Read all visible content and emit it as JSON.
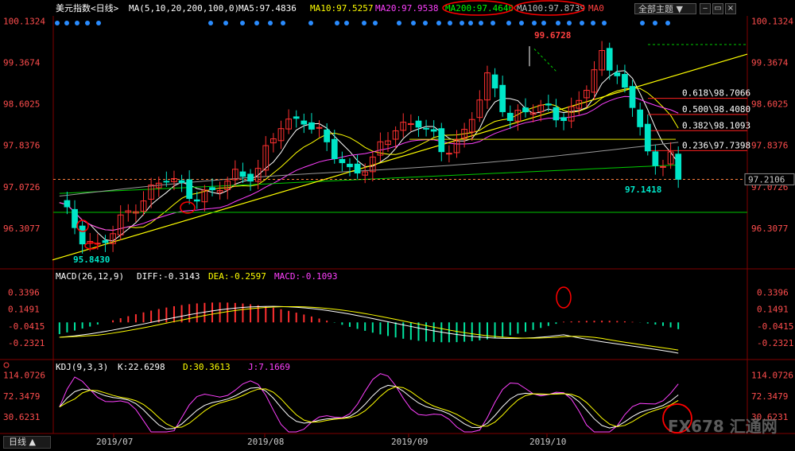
{
  "header": {
    "instrument": "美元指数<日线>",
    "ma_params": "MA(5,10,20,200,100,0)",
    "ma5": "MA5:97.4836",
    "ma10": "MA10:97.5257",
    "ma20": "MA20:97.9538",
    "ma200": "MA200:97.4640",
    "ma100": "MA100:97.8739",
    "ma0": "MA0",
    "theme_button": "全部主题",
    "theme_arrow": "▼"
  },
  "macd_header": {
    "params": "MACD(26,12,9)",
    "diff": "DIFF:-0.3143",
    "dea": "DEA:-0.2597",
    "macd": "MACD:-0.1093"
  },
  "kdj_header": {
    "params": "KDJ(9,3,3)",
    "k": "K:22.6298",
    "d": "D:30.3613",
    "j": "J:7.1669"
  },
  "footer": {
    "period": "日线",
    "period_arrow": "▲"
  },
  "watermark": "FX678 汇通网",
  "chart_data": [
    {
      "type": "candlestick",
      "title": "美元指数<日线>",
      "y_ticks": [
        "100.1324",
        "99.3674",
        "98.6025",
        "97.8376",
        "97.0726",
        "96.3077"
      ],
      "x_ticks": [
        "2019/07",
        "2019/08",
        "2019/09",
        "2019/10"
      ],
      "ylim": [
        95.6,
        100.2
      ],
      "annotations": {
        "high": "99.6728",
        "low": "95.8430",
        "recent_low": "97.1418",
        "current_price": "97.2106"
      },
      "fibonacci": [
        {
          "label": "0.618\\98.7066",
          "value": 98.7066
        },
        {
          "label": "0.500\\98.4080",
          "value": 98.408
        },
        {
          "label": "0.382\\98.1093",
          "value": 98.1093
        },
        {
          "label": "0.236\\97.7398",
          "value": 97.7398
        }
      ],
      "series": [
        {
          "name": "MA5",
          "value": 97.4836
        },
        {
          "name": "MA10",
          "value": 97.5257
        },
        {
          "name": "MA20",
          "value": 97.9538
        },
        {
          "name": "MA200",
          "value": 97.464
        },
        {
          "name": "MA100",
          "value": 97.8739
        }
      ]
    },
    {
      "type": "bar",
      "title": "MACD(26,12,9)",
      "y_ticks": [
        "0.3396",
        "0.1491",
        "-0.0415",
        "-0.2321"
      ],
      "ylim": [
        -0.4,
        0.45
      ],
      "series": [
        {
          "name": "DIFF",
          "value": -0.3143
        },
        {
          "name": "DEA",
          "value": -0.2597
        },
        {
          "name": "MACD",
          "value": -0.1093
        }
      ]
    },
    {
      "type": "line",
      "title": "KDJ(9,3,3)",
      "y_ticks": [
        "114.0726",
        "72.3479",
        "30.6231"
      ],
      "ylim": [
        0,
        120
      ],
      "series": [
        {
          "name": "K",
          "value": 22.6298
        },
        {
          "name": "D",
          "value": 30.3613
        },
        {
          "name": "J",
          "value": 7.1669
        }
      ]
    }
  ]
}
